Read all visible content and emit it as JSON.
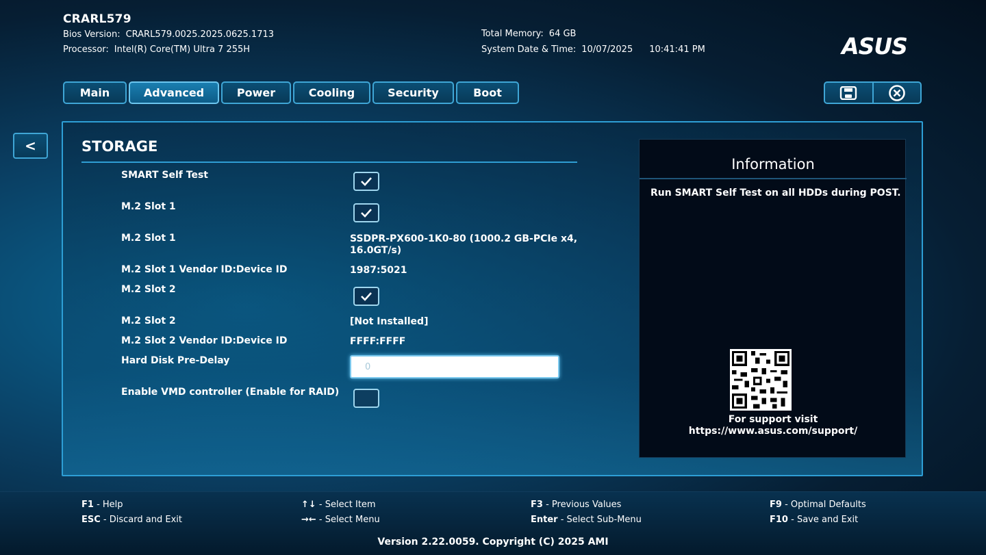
{
  "header": {
    "model": "CRARL579",
    "bios_label": "Bios Version:",
    "bios_value": "CRARL579.0025.2025.0625.1713",
    "processor_label": "Processor:",
    "processor_value": "Intel(R) Core(TM) Ultra 7 255H",
    "memory_label": "Total Memory:",
    "memory_value": "64 GB",
    "datetime_label": "System Date & Time:",
    "date_value": "10/07/2025",
    "time_value": "10:41:41 PM",
    "brand": "ASUS"
  },
  "tabs": [
    {
      "label": "Main",
      "active": false
    },
    {
      "label": "Advanced",
      "active": true
    },
    {
      "label": "Power",
      "active": false
    },
    {
      "label": "Cooling",
      "active": false
    },
    {
      "label": "Security",
      "active": false
    },
    {
      "label": "Boot",
      "active": false
    }
  ],
  "toolbar": {
    "save_icon": "save-icon",
    "exit_icon": "close-circle-icon"
  },
  "back_label": "<",
  "section": {
    "title": "STORAGE",
    "rows": [
      {
        "label": "SMART Self Test",
        "type": "checkbox",
        "checked": true
      },
      {
        "label": "M.2 Slot 1",
        "type": "checkbox",
        "checked": true
      },
      {
        "label": "M.2 Slot 1",
        "type": "text",
        "value_line1": "SSDPR-PX600-1K0-80 (1000.2 GB-PCIe x4,",
        "value_line2": "16.0GT/s)"
      },
      {
        "label": "M.2 Slot 1 Vendor ID:Device ID",
        "type": "text",
        "value": "1987:5021"
      },
      {
        "label": "M.2 Slot 2",
        "type": "checkbox",
        "checked": true
      },
      {
        "label": "M.2 Slot 2",
        "type": "text",
        "value": "[Not Installed]"
      },
      {
        "label": "M.2 Slot 2 Vendor ID:Device ID",
        "type": "text",
        "value": "FFFF:FFFF"
      },
      {
        "label": "Hard Disk Pre-Delay",
        "type": "input",
        "value": "0"
      },
      {
        "label": "Enable VMD controller (Enable for RAID)",
        "type": "checkbox",
        "checked": false
      }
    ]
  },
  "info": {
    "title": "Information",
    "text": "Run SMART Self Test on all HDDs during POST.",
    "support_line1": "For support visit",
    "support_line2": "https://www.asus.com/support/"
  },
  "footer": {
    "keys": [
      {
        "key": "F1",
        "action": " - Help"
      },
      {
        "key": "ESC",
        "action": " - Discard and Exit"
      },
      {
        "key": "↑↓",
        "action": " - Select Item"
      },
      {
        "key": "→←",
        "action": " - Select Menu"
      },
      {
        "key": "F3",
        "action": " - Previous Values"
      },
      {
        "key": "Enter",
        "action": " - Select Sub-Menu"
      },
      {
        "key": "F9",
        "action": " - Optimal Defaults"
      },
      {
        "key": "F10",
        "action": " - Save and Exit"
      }
    ],
    "version": "Version 2.22.0059. Copyright (C) 2025 AMI"
  }
}
